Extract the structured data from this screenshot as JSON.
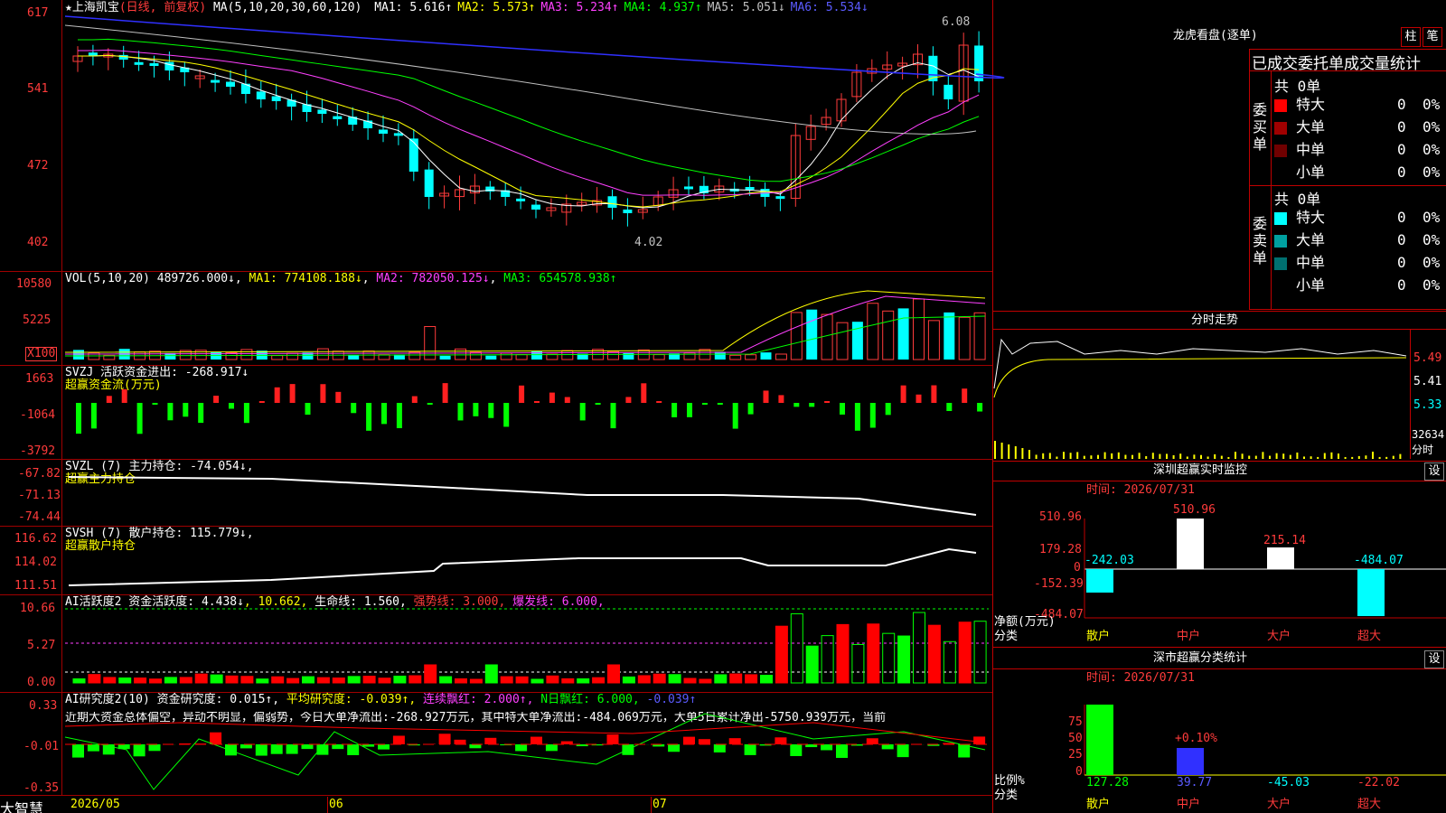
{
  "header": {
    "star": "★",
    "stock_name": "上海凯宝",
    "period_label": "(日线, 前复权)",
    "ma_title": "MA(5,10,20,30,60,120)",
    "ma": [
      {
        "label": "MA1:",
        "value": "5.616↑",
        "color": "#ffffff"
      },
      {
        "label": "MA2:",
        "value": "5.573↑",
        "color": "#ffff00"
      },
      {
        "label": "MA3:",
        "value": "5.234↑",
        "color": "#ff40ff"
      },
      {
        "label": "MA4:",
        "value": "4.937↑",
        "color": "#00ff00"
      },
      {
        "label": "MA5:",
        "value": "5.051↓",
        "color": "#c0c0c0"
      },
      {
        "label": "MA6:",
        "value": "5.534↓",
        "color": "#5b5bff"
      }
    ],
    "max_label": "6.08",
    "min_label": "4.02"
  },
  "price_axis": [
    "617",
    "541",
    "472",
    "402"
  ],
  "vol_panel": {
    "title": "VOL(5,10,20)",
    "vol": "489726.000↓",
    "ma1": "MA1: 774108.188↓",
    "ma2": "MA2: 782050.125↓",
    "ma3": "MA3: 654578.938↑",
    "axis": [
      "10580",
      "5225",
      "X100"
    ]
  },
  "svzj_panel": {
    "title": "SVZJ  活跃资金进出: -268.917↓",
    "sub": "超赢资金流(万元)",
    "axis": [
      "1663",
      "-1064",
      "-3792"
    ]
  },
  "svzl_panel": {
    "title": "SVZL (7) 主力持仓: -74.054↓,",
    "sub": "超赢主力持仓",
    "axis": [
      "-67.82",
      "-71.13",
      "-74.44"
    ]
  },
  "svsh_panel": {
    "title": "SVSH (7) 散户持仓: 115.779↓,",
    "sub": "超赢散户持仓",
    "axis": [
      "116.62",
      "114.02",
      "111.51"
    ]
  },
  "ai_active_panel": {
    "title": "AI活跃度2 资金活跃度: 4.438↓",
    "v2": ", 10.662,",
    "v3": " 生命线: 1.560,",
    "v4": " 强势线: 3.000,",
    "v5": " 爆发线: 6.000,",
    "axis": [
      "10.66",
      "5.27",
      "0.00"
    ]
  },
  "ai_research_panel": {
    "title": "AI研究度2(10) 资金研究度: 0.015↑,",
    "v2": " 平均研究度: -0.039↑,",
    "v3": " 连续飘红: 2.000↑,",
    "v4": " N日飘红: 6.000,",
    "v5": " -0.039↑",
    "text": "近期大资金总体偏空，异动不明显，偏弱势，今日大单净流出:-268.927万元，其中特大单净流出:-484.069万元，大单5日累计净出-5750.939万元，当前",
    "axis": [
      "0.33",
      "-0.01",
      "-0.35"
    ]
  },
  "date_axis": {
    "brand": "大智慧",
    "dates": [
      "2026/05",
      "06",
      "07"
    ]
  },
  "right_panel": {
    "dragon_title": "龙虎看盘(逐单)",
    "btn_zhu": "柱",
    "btn_bi": "笔",
    "stats_title": "已成交委托单成交量统计",
    "buy_label": "委买单",
    "sell_label": "委卖单",
    "buy_total": "共 0单",
    "sell_total": "共 0单",
    "buy_rows": [
      {
        "name": "特大",
        "count": "0",
        "pct": "0%",
        "color": "#ff0000"
      },
      {
        "name": "大单",
        "count": "0",
        "pct": "0%",
        "color": "#a00000"
      },
      {
        "name": "中单",
        "count": "0",
        "pct": "0%",
        "color": "#700000"
      },
      {
        "name": "小单",
        "count": "0",
        "pct": "0%",
        "color": "#000000"
      }
    ],
    "sell_rows": [
      {
        "name": "特大",
        "count": "0",
        "pct": "0%",
        "color": "#00ffff"
      },
      {
        "name": "大单",
        "count": "0",
        "pct": "0%",
        "color": "#00a0a0"
      },
      {
        "name": "中单",
        "count": "0",
        "pct": "0%",
        "color": "#007070"
      },
      {
        "name": "小单",
        "count": "0",
        "pct": "0%",
        "color": "#000000"
      }
    ],
    "trend_title": "分时走势",
    "trend_axis": [
      "5.49",
      "5.41",
      "5.33"
    ],
    "trend_vol": "32634",
    "trend_vol_label": "分时",
    "monitor_title": "深圳超赢实时监控",
    "settings": "设",
    "monitor_time": "时间: 2026/07/31",
    "monitor_axis": [
      "510.96",
      "179.28",
      "0",
      "-152.39",
      "-484.07"
    ],
    "monitor_values": [
      "-242.03",
      "510.96",
      "215.14",
      "-484.07"
    ],
    "monitor_ylabel": "净额(万元)",
    "monitor_xlabel": "分类",
    "categories": [
      "散户",
      "中户",
      "大户",
      "超大"
    ],
    "class_title": "深市超赢分类统计",
    "class_time": "时间: 2026/07/31",
    "class_axis": [
      "75",
      "50",
      "25",
      "0"
    ],
    "class_pct": "+0.10%",
    "class_values": [
      "127.28",
      "39.77",
      "-45.03",
      "-22.02"
    ],
    "class_ylabel": "比例%",
    "class_xlabel": "分类"
  }
}
